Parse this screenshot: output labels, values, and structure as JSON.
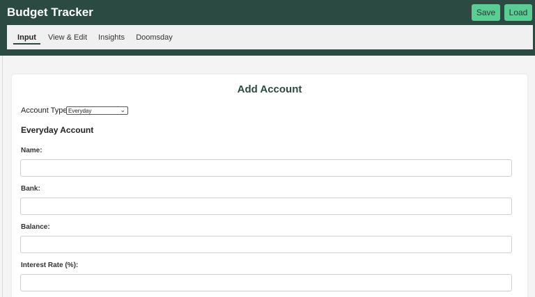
{
  "header": {
    "title": "Budget Tracker",
    "save_label": "Save",
    "load_label": "Load",
    "colors": {
      "header_bg": "#2a4a42",
      "button_bg": "#5ccb94"
    }
  },
  "nav": {
    "tabs": [
      {
        "label": "Input",
        "active": true
      },
      {
        "label": "View & Edit",
        "active": false
      },
      {
        "label": "Insights",
        "active": false
      },
      {
        "label": "Doomsday",
        "active": false
      }
    ]
  },
  "form": {
    "title": "Add Account",
    "account_type_label": "Account Type:",
    "account_type_value": "Everyday",
    "section_title": "Everyday Account",
    "fields": [
      {
        "label": "Name:",
        "value": ""
      },
      {
        "label": "Bank:",
        "value": ""
      },
      {
        "label": "Balance:",
        "value": ""
      },
      {
        "label": "Interest Rate (%):",
        "value": ""
      }
    ]
  }
}
